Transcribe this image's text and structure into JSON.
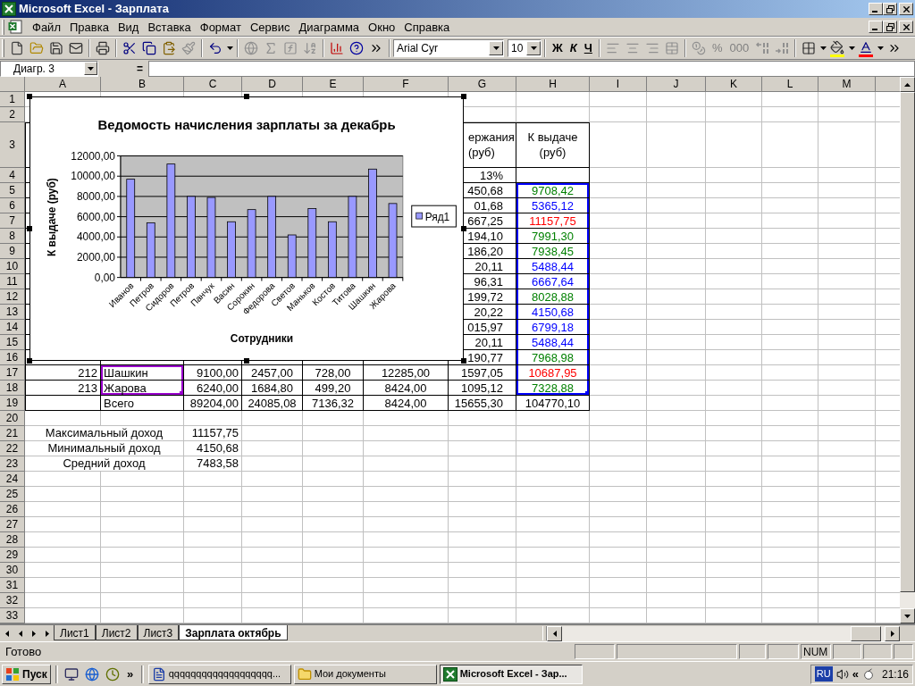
{
  "window": {
    "title": "Microsoft Excel - Зарплата"
  },
  "menu": [
    "Файл",
    "Правка",
    "Вид",
    "Вставка",
    "Формат",
    "Сервис",
    "Диаграмма",
    "Окно",
    "Справка"
  ],
  "toolbar": {
    "standard": [
      {
        "kind": "new",
        "disabled": false
      },
      {
        "kind": "open",
        "disabled": false
      },
      {
        "kind": "save",
        "disabled": false
      },
      {
        "kind": "mail",
        "disabled": false
      },
      {
        "kind": "print",
        "disabled": false
      },
      {
        "kind": "cut",
        "disabled": false
      },
      {
        "kind": "copy",
        "disabled": false
      },
      {
        "kind": "paste",
        "disabled": false
      },
      {
        "kind": "format_painter",
        "disabled": true
      },
      {
        "kind": "undo",
        "disabled": false
      },
      {
        "kind": "hyperlink",
        "disabled": true
      },
      {
        "kind": "autosum",
        "disabled": true
      },
      {
        "kind": "function",
        "disabled": true
      },
      {
        "kind": "sort",
        "disabled": true
      },
      {
        "kind": "chart",
        "disabled": false
      },
      {
        "kind": "help",
        "disabled": false
      },
      {
        "kind": "more",
        "disabled": false
      }
    ],
    "font": "Arial Cyr",
    "size": "10",
    "formatting": [
      {
        "kind": "bold",
        "label": "Ж",
        "disabled": false
      },
      {
        "kind": "italic",
        "label": "К",
        "disabled": false
      },
      {
        "kind": "underline",
        "label": "Ч",
        "disabled": false
      },
      {
        "kind": "align_left",
        "disabled": true
      },
      {
        "kind": "align_center",
        "disabled": true
      },
      {
        "kind": "align_right",
        "disabled": true
      },
      {
        "kind": "merge",
        "disabled": true
      },
      {
        "kind": "currency",
        "disabled": true
      },
      {
        "kind": "percent",
        "label": "%",
        "disabled": true
      },
      {
        "kind": "thousands",
        "label": "000",
        "disabled": true
      },
      {
        "kind": "increase_decimal",
        "disabled": true
      },
      {
        "kind": "decrease_decimal",
        "disabled": true
      },
      {
        "kind": "borders",
        "disabled": false
      },
      {
        "kind": "fill",
        "disabled": false
      },
      {
        "kind": "font_color",
        "disabled": false
      },
      {
        "kind": "more",
        "disabled": false
      }
    ]
  },
  "formula_bar": {
    "name_box": "Диагр. 3",
    "equals": "="
  },
  "columns": [
    "A",
    "B",
    "C",
    "D",
    "E",
    "F",
    "G",
    "H",
    "I",
    "J",
    "K",
    "L",
    "M"
  ],
  "rows": [
    {
      "number": "1",
      "kind": "plain"
    },
    {
      "number": "2",
      "kind": "plain"
    },
    {
      "number": "3",
      "kind": "header",
      "cells": {
        "G": {
          "text": "ержания (руб)"
        },
        "H": {
          "text": "К выдаче (руб)"
        }
      }
    },
    {
      "number": "4",
      "kind": "table",
      "cells": {
        "G": {
          "text": "13%"
        }
      }
    },
    {
      "number": "5",
      "kind": "table",
      "cells": {
        "G": {
          "text": "450,68"
        },
        "H": {
          "text": "9708,42",
          "color": "#008000",
          "highlighted": true
        }
      }
    },
    {
      "number": "6",
      "kind": "table",
      "cells": {
        "G": {
          "text": "01,68"
        },
        "H": {
          "text": "5365,12",
          "color": "#0000ff",
          "highlighted": true
        }
      }
    },
    {
      "number": "7",
      "kind": "table",
      "cells": {
        "G": {
          "text": "667,25"
        },
        "H": {
          "text": "11157,75",
          "color": "#ff0000",
          "highlighted": true
        }
      }
    },
    {
      "number": "8",
      "kind": "table",
      "cells": {
        "G": {
          "text": "194,10"
        },
        "H": {
          "text": "7991,30",
          "color": "#008000",
          "highlighted": true
        }
      }
    },
    {
      "number": "9",
      "kind": "table",
      "cells": {
        "G": {
          "text": "186,20"
        },
        "H": {
          "text": "7938,45",
          "color": "#008000",
          "highlighted": true
        }
      }
    },
    {
      "number": "10",
      "kind": "table",
      "cells": {
        "G": {
          "text": "20,11"
        },
        "H": {
          "text": "5488,44",
          "color": "#0000ff",
          "highlighted": true
        }
      }
    },
    {
      "number": "11",
      "kind": "table",
      "cells": {
        "G": {
          "text": "96,31"
        },
        "H": {
          "text": "6667,64",
          "color": "#0000ff",
          "highlighted": true
        }
      }
    },
    {
      "number": "12",
      "kind": "table",
      "cells": {
        "G": {
          "text": "199,72"
        },
        "H": {
          "text": "8028,88",
          "color": "#008000",
          "highlighted": true
        }
      }
    },
    {
      "number": "13",
      "kind": "table",
      "cells": {
        "G": {
          "text": "20,22"
        },
        "H": {
          "text": "4150,68",
          "color": "#0000ff",
          "highlighted": true
        }
      }
    },
    {
      "number": "14",
      "kind": "table",
      "cells": {
        "G": {
          "text": "015,97"
        },
        "H": {
          "text": "6799,18",
          "color": "#0000ff",
          "highlighted": true
        }
      }
    },
    {
      "number": "15",
      "kind": "table",
      "cells": {
        "G": {
          "text": "20,11"
        },
        "H": {
          "text": "5488,44",
          "color": "#0000ff",
          "highlighted": true
        }
      }
    },
    {
      "number": "16",
      "kind": "table",
      "cells": {
        "G": {
          "text": "190,77"
        },
        "H": {
          "text": "7968,98",
          "color": "#008000",
          "highlighted": true
        }
      }
    },
    {
      "number": "17",
      "kind": "table",
      "cells": {
        "A": {
          "text": "212"
        },
        "B": {
          "text": "Шашкин",
          "highlighted": true
        },
        "C": {
          "text": "9100,00"
        },
        "D": {
          "text": "2457,00"
        },
        "E": {
          "text": "728,00"
        },
        "F": {
          "text": "12285,00"
        },
        "G": {
          "text": "1597,05"
        },
        "H": {
          "text": "10687,95",
          "color": "#ff0000",
          "highlighted": true
        }
      }
    },
    {
      "number": "18",
      "kind": "table",
      "cells": {
        "A": {
          "text": "213"
        },
        "B": {
          "text": "Жарова",
          "highlighted": true
        },
        "C": {
          "text": "6240,00"
        },
        "D": {
          "text": "1684,80"
        },
        "E": {
          "text": "499,20"
        },
        "F": {
          "text": "8424,00"
        },
        "G": {
          "text": "1095,12"
        },
        "H": {
          "text": "7328,88",
          "color": "#008000",
          "highlighted": true
        }
      }
    },
    {
      "number": "19",
      "kind": "table",
      "cells": {
        "B": {
          "text": "Всего"
        },
        "C": {
          "text": "89204,00"
        },
        "D": {
          "text": "24085,08"
        },
        "E": {
          "text": "7136,32"
        },
        "F": {
          "text": "8424,00"
        },
        "G": {
          "text": "15655,30"
        },
        "H": {
          "text": "104770,10"
        }
      }
    },
    {
      "number": "20",
      "kind": "plain"
    },
    {
      "number": "21",
      "kind": "summary",
      "label": "Максимальный доход",
      "value": "11157,75"
    },
    {
      "number": "22",
      "kind": "summary",
      "label": "Минимальный доход",
      "value": "4150,68"
    },
    {
      "number": "23",
      "kind": "summary",
      "label": "Средний доход",
      "value": "7483,58"
    },
    {
      "number": "24",
      "kind": "plain"
    },
    {
      "number": "25",
      "kind": "plain"
    },
    {
      "number": "26",
      "kind": "plain"
    },
    {
      "number": "27",
      "kind": "plain"
    },
    {
      "number": "28",
      "kind": "plain"
    },
    {
      "number": "29",
      "kind": "plain"
    },
    {
      "number": "30",
      "kind": "plain"
    },
    {
      "number": "31",
      "kind": "plain"
    },
    {
      "number": "32",
      "kind": "plain"
    },
    {
      "number": "33",
      "kind": "plain"
    }
  ],
  "chart": {
    "chart_data": {
      "type": "bar",
      "title": "Ведомость начисления зарплаты за декабрь",
      "xlabel": "Сотрудники",
      "ylabel": "К выдаче (руб)",
      "categories": [
        "Иванов",
        "Петров",
        "Сидоров",
        "Петров",
        "Панчук",
        "Васин",
        "Сорокин",
        "Федорова",
        "Светов",
        "Маньков",
        "Костов",
        "Титова",
        "Шашкин",
        "Жарова"
      ],
      "series": [
        {
          "name": "Ряд1",
          "color": "#9999ff",
          "values": [
            9700,
            5400,
            11200,
            8000,
            7900,
            5500,
            6700,
            8000,
            4200,
            6800,
            5500,
            8000,
            10700,
            7300
          ]
        }
      ],
      "grid": true,
      "ylim": [
        0,
        12000
      ],
      "yticks": [
        {
          "value": 0,
          "label": "0,00"
        },
        {
          "value": 2000,
          "label": "2000,00"
        },
        {
          "value": 4000,
          "label": "4000,00"
        },
        {
          "value": 6000,
          "label": "6000,00"
        },
        {
          "value": 8000,
          "label": "8000,00"
        },
        {
          "value": 10000,
          "label": "10000,00"
        },
        {
          "value": 12000,
          "label": "12000,00"
        }
      ]
    }
  },
  "sheet_tabs": [
    {
      "label": "Лист1",
      "selected": false
    },
    {
      "label": "Лист2",
      "selected": false
    },
    {
      "label": "Лист3",
      "selected": false
    },
    {
      "label": "Зарплата октябрь",
      "selected": true
    }
  ],
  "status_bar": {
    "text": "Готово",
    "num": "NUM"
  },
  "taskbar": {
    "start": "Пуск",
    "more": "»",
    "tasks": [
      {
        "kind": "word",
        "label": "qqqqqqqqqqqqqqqqqqq...",
        "selected": false
      },
      {
        "kind": "folder",
        "label": "Мои документы",
        "selected": false
      },
      {
        "kind": "excel",
        "label": "Microsoft Excel - Зар...",
        "selected": true
      }
    ],
    "language": "RU",
    "tray_more": "«",
    "clock": "21:16"
  }
}
